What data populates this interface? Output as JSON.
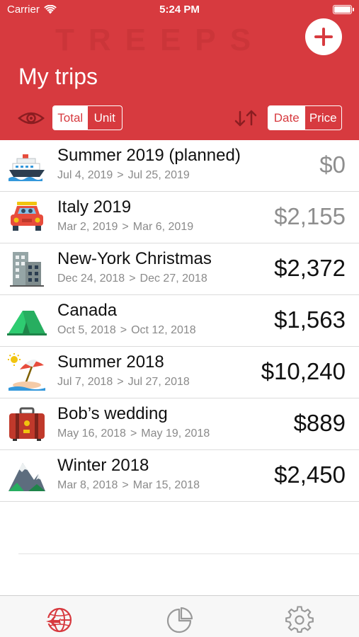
{
  "status_bar": {
    "carrier": "Carrier",
    "time": "5:24 PM"
  },
  "header": {
    "brand": "TREEPS",
    "title": "My trips",
    "view_toggle": {
      "options": [
        "Total",
        "Unit"
      ],
      "selected": "Total"
    },
    "sort_toggle": {
      "options": [
        "Date",
        "Price"
      ],
      "selected": "Date"
    },
    "accent_color": "#d73a3f"
  },
  "trips": [
    {
      "icon": "cruise-ship-icon",
      "name": "Summer 2019 (planned)",
      "start": "Jul 4, 2019",
      "separator": ">",
      "end": "Jul 25, 2019",
      "amount": "$0",
      "amount_style": "muted"
    },
    {
      "icon": "car-icon",
      "name": "Italy 2019",
      "start": "Mar 2, 2019",
      "separator": ">",
      "end": "Mar 6, 2019",
      "amount": "$2,155",
      "amount_style": "muted"
    },
    {
      "icon": "building-icon",
      "name": "New-York Christmas",
      "start": "Dec 24, 2018",
      "separator": ">",
      "end": "Dec 27, 2018",
      "amount": "$2,372",
      "amount_style": "strong"
    },
    {
      "icon": "tent-icon",
      "name": "Canada",
      "start": "Oct 5, 2018",
      "separator": ">",
      "end": "Oct 12, 2018",
      "amount": "$1,563",
      "amount_style": "strong"
    },
    {
      "icon": "beach-umbrella-icon",
      "name": "Summer 2018",
      "start": "Jul 7, 2018",
      "separator": ">",
      "end": "Jul 27, 2018",
      "amount": "$10,240",
      "amount_style": "strong"
    },
    {
      "icon": "suitcase-icon",
      "name": "Bob’s wedding",
      "start": "May 16, 2018",
      "separator": ">",
      "end": "May 19, 2018",
      "amount": "$889",
      "amount_style": "strong"
    },
    {
      "icon": "mountain-icon",
      "name": "Winter 2018",
      "start": "Mar 8, 2018",
      "separator": ">",
      "end": "Mar 15, 2018",
      "amount": "$2,450",
      "amount_style": "strong"
    }
  ],
  "tabbar": {
    "tabs": [
      {
        "icon": "globe-plane-icon",
        "active": true
      },
      {
        "icon": "pie-chart-icon",
        "active": false
      },
      {
        "icon": "gear-icon",
        "active": false
      }
    ]
  }
}
